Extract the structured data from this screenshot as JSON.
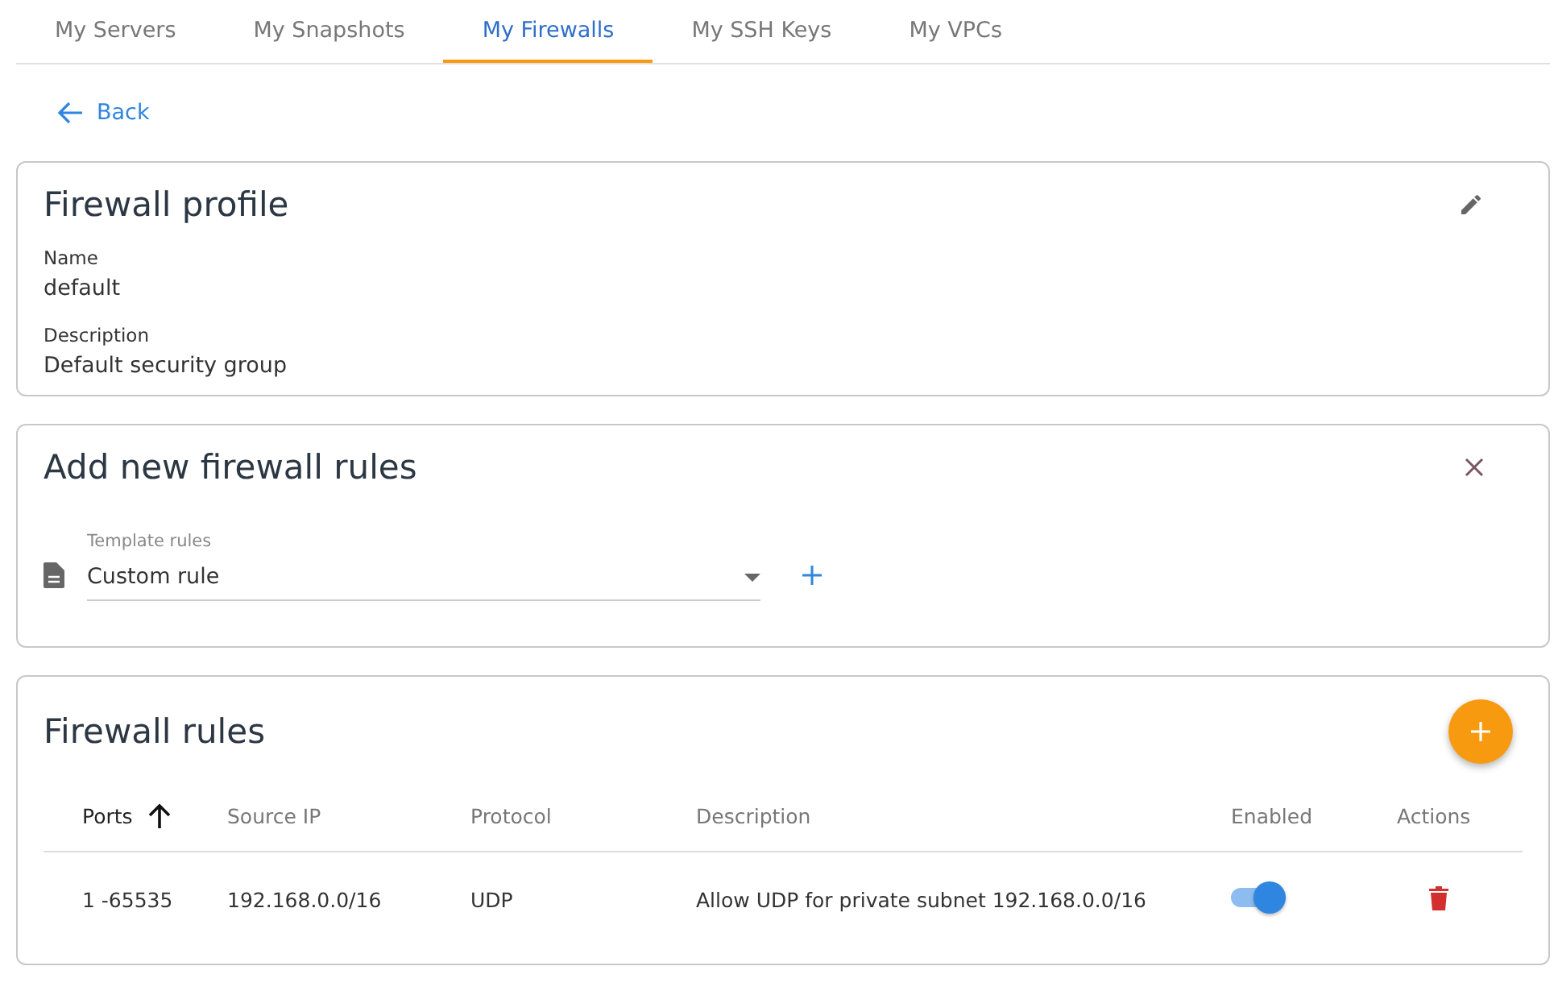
{
  "tabs": [
    {
      "label": "My Servers",
      "selected": false
    },
    {
      "label": "My Snapshots",
      "selected": false
    },
    {
      "label": "My Firewalls",
      "selected": true
    },
    {
      "label": "My SSH Keys",
      "selected": false
    },
    {
      "label": "My VPCs",
      "selected": false
    }
  ],
  "back_link": "Back",
  "profile": {
    "title": "Firewall profile",
    "fields": [
      {
        "label": "Name",
        "value": "default"
      },
      {
        "label": "Description",
        "value": "Default security group"
      }
    ]
  },
  "add_rules": {
    "title": "Add new firewall rules",
    "template": {
      "label": "Template rules",
      "value": "Custom rule"
    }
  },
  "rules": {
    "title": "Firewall rules",
    "columns": [
      {
        "label": "Ports",
        "sorted": true
      },
      {
        "label": "Source IP",
        "sorted": false
      },
      {
        "label": "Protocol",
        "sorted": false
      },
      {
        "label": "Description",
        "sorted": false
      },
      {
        "label": "Enabled",
        "sorted": false
      },
      {
        "label": "Actions",
        "sorted": false
      }
    ],
    "rows": [
      {
        "ports": "1 -65535",
        "source_ip": "192.168.0.0/16",
        "protocol": "UDP",
        "description": "Allow UDP for private subnet 192.168.0.0/16",
        "enabled": true
      }
    ]
  }
}
